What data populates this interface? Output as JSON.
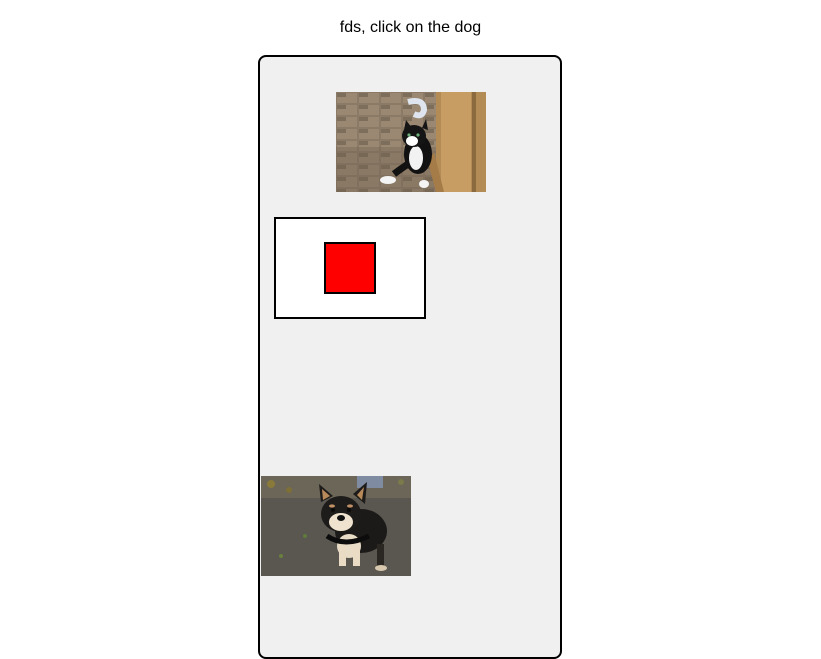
{
  "instruction": "fds, click on the dog",
  "images": [
    {
      "subject": "cat",
      "icon": "cat-photo"
    },
    {
      "subject": "dog",
      "icon": "dog-photo"
    }
  ],
  "colors": {
    "panel_background": "#f0f0f0",
    "red_square": "#ff0000",
    "border": "#000000"
  }
}
